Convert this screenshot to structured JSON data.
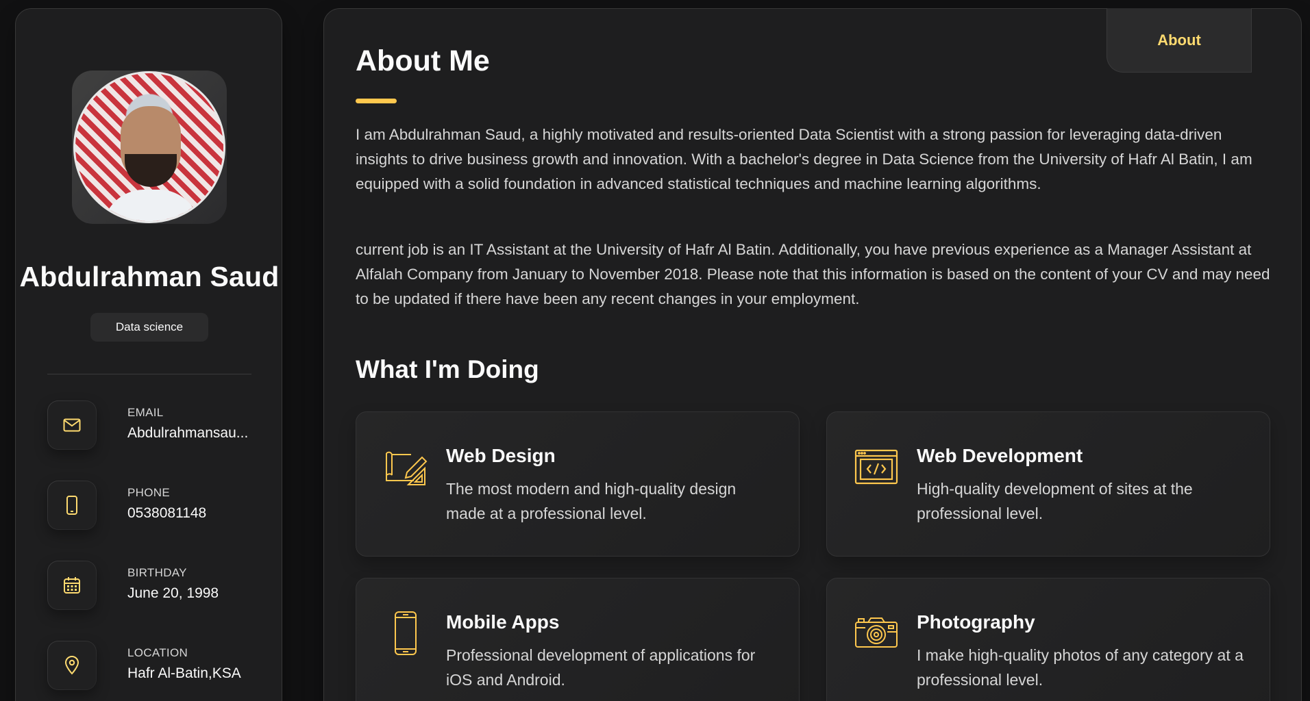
{
  "sidebar": {
    "name": "Abdulrahman Saud",
    "title": "Data science",
    "contacts": [
      {
        "label": "Email",
        "value": "Abdulrahmansau...",
        "icon": "mail-icon"
      },
      {
        "label": "Phone",
        "value": "0538081148",
        "icon": "phone-icon"
      },
      {
        "label": "Birthday",
        "value": "June 20, 1998",
        "icon": "calendar-icon"
      },
      {
        "label": "Location",
        "value": "Hafr Al-Batin,KSA",
        "icon": "location-icon"
      }
    ]
  },
  "navbar": {
    "active_link": "About"
  },
  "about": {
    "title": "About Me",
    "paragraphs": [
      "I am Abdulrahman Saud, a highly motivated and results-oriented Data Scientist with a strong passion for leveraging data-driven insights to drive business growth and innovation. With a bachelor's degree in Data Science from the University of Hafr Al Batin, I am equipped with a solid foundation in advanced statistical techniques and machine learning algorithms.",
      "current job is an IT Assistant at the University of Hafr Al Batin. Additionally, you have previous experience as a Manager Assistant at Alfalah Company from January to November 2018. Please note that this information is based on the content of your CV and may need to be updated if there have been any recent changes in your employment."
    ],
    "services_title": "What I'm Doing",
    "services": [
      {
        "title": "Web Design",
        "text": "The most modern and high-quality design made at a professional level.",
        "icon": "design-icon"
      },
      {
        "title": "Web Development",
        "text": "High-quality development of sites at the professional level.",
        "icon": "code-window-icon"
      },
      {
        "title": "Mobile Apps",
        "text": "Professional development of applications for iOS and Android.",
        "icon": "mobile-icon"
      },
      {
        "title": "Photography",
        "text": "I make high-quality photos of any category at a professional level.",
        "icon": "camera-icon"
      }
    ]
  },
  "colors": {
    "accent": "#ffdb70",
    "background": "#121212",
    "card": "#1e1e1f"
  }
}
